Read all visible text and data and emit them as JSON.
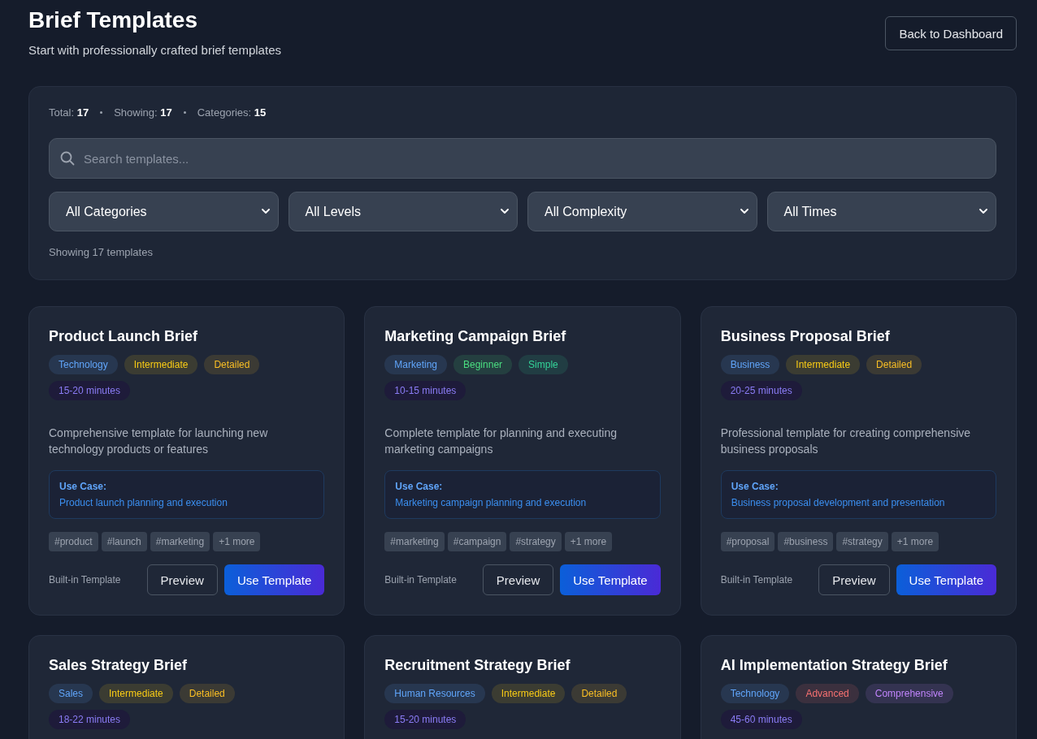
{
  "header": {
    "title": "Brief Templates",
    "subtitle": "Start with professionally crafted brief templates",
    "back_button": "Back to Dashboard"
  },
  "filters": {
    "stats": [
      "Total: **17**",
      "Showing: **17**",
      "Categories: **15**"
    ],
    "search": {
      "placeholder": "Search templates..."
    },
    "dropdowns": [
      "All Categories",
      "All Levels",
      "All Complexity",
      "All Times"
    ],
    "result_text": "Showing 17 templates"
  },
  "templates": [
    {
      "title": "Product Launch Brief",
      "badges": [
        {
          "label": "Technology",
          "color": "#60a5fa"
        },
        {
          "label": "Intermediate",
          "color": "#facc15"
        },
        {
          "label": "Detailed",
          "color": "#fbbf24"
        }
      ],
      "time": "15-20 minutes",
      "description": "Comprehensive template for launching new technology products or features",
      "use_case_label": "Use Case:",
      "use_case": "Product launch planning and execution",
      "tags": [
        "#product",
        "#launch",
        "#marketing",
        "+1 more"
      ],
      "source": "Built-in Template",
      "buttons": [
        "Preview",
        "Use Template"
      ]
    },
    {
      "title": "Marketing Campaign Brief",
      "badges": [
        {
          "label": "Marketing",
          "color": "#60a5fa"
        },
        {
          "label": "Beginner",
          "color": "#4ade80"
        },
        {
          "label": "Simple",
          "color": "#34d399"
        }
      ],
      "time": "10-15 minutes",
      "description": "Complete template for planning and executing marketing campaigns",
      "use_case_label": "Use Case:",
      "use_case": "Marketing campaign planning and execution",
      "tags": [
        "#marketing",
        "#campaign",
        "#strategy",
        "+1 more"
      ],
      "source": "Built-in Template",
      "buttons": [
        "Preview",
        "Use Template"
      ]
    },
    {
      "title": "Business Proposal Brief",
      "badges": [
        {
          "label": "Business",
          "color": "#60a5fa"
        },
        {
          "label": "Intermediate",
          "color": "#facc15"
        },
        {
          "label": "Detailed",
          "color": "#fbbf24"
        }
      ],
      "time": "20-25 minutes",
      "description": "Professional template for creating comprehensive business proposals",
      "use_case_label": "Use Case:",
      "use_case": "Business proposal development and presentation",
      "tags": [
        "#proposal",
        "#business",
        "#strategy",
        "+1 more"
      ],
      "source": "Built-in Template",
      "buttons": [
        "Preview",
        "Use Template"
      ]
    },
    {
      "title": "Sales Strategy Brief",
      "badges": [
        {
          "label": "Sales",
          "color": "#60a5fa"
        },
        {
          "label": "Intermediate",
          "color": "#facc15"
        },
        {
          "label": "Detailed",
          "color": "#fbbf24"
        }
      ],
      "time": "18-22 minutes"
    },
    {
      "title": "Recruitment Strategy Brief",
      "badges": [
        {
          "label": "Human Resources",
          "color": "#60a5fa"
        },
        {
          "label": "Intermediate",
          "color": "#facc15"
        },
        {
          "label": "Detailed",
          "color": "#fbbf24"
        }
      ],
      "time": "15-20 minutes"
    },
    {
      "title": "AI Implementation Strategy Brief",
      "badges": [
        {
          "label": "Technology",
          "color": "#60a5fa"
        },
        {
          "label": "Advanced",
          "color": "#f87171"
        },
        {
          "label": "Comprehensive",
          "color": "#c084fc"
        }
      ],
      "time": "45-60 minutes"
    }
  ]
}
